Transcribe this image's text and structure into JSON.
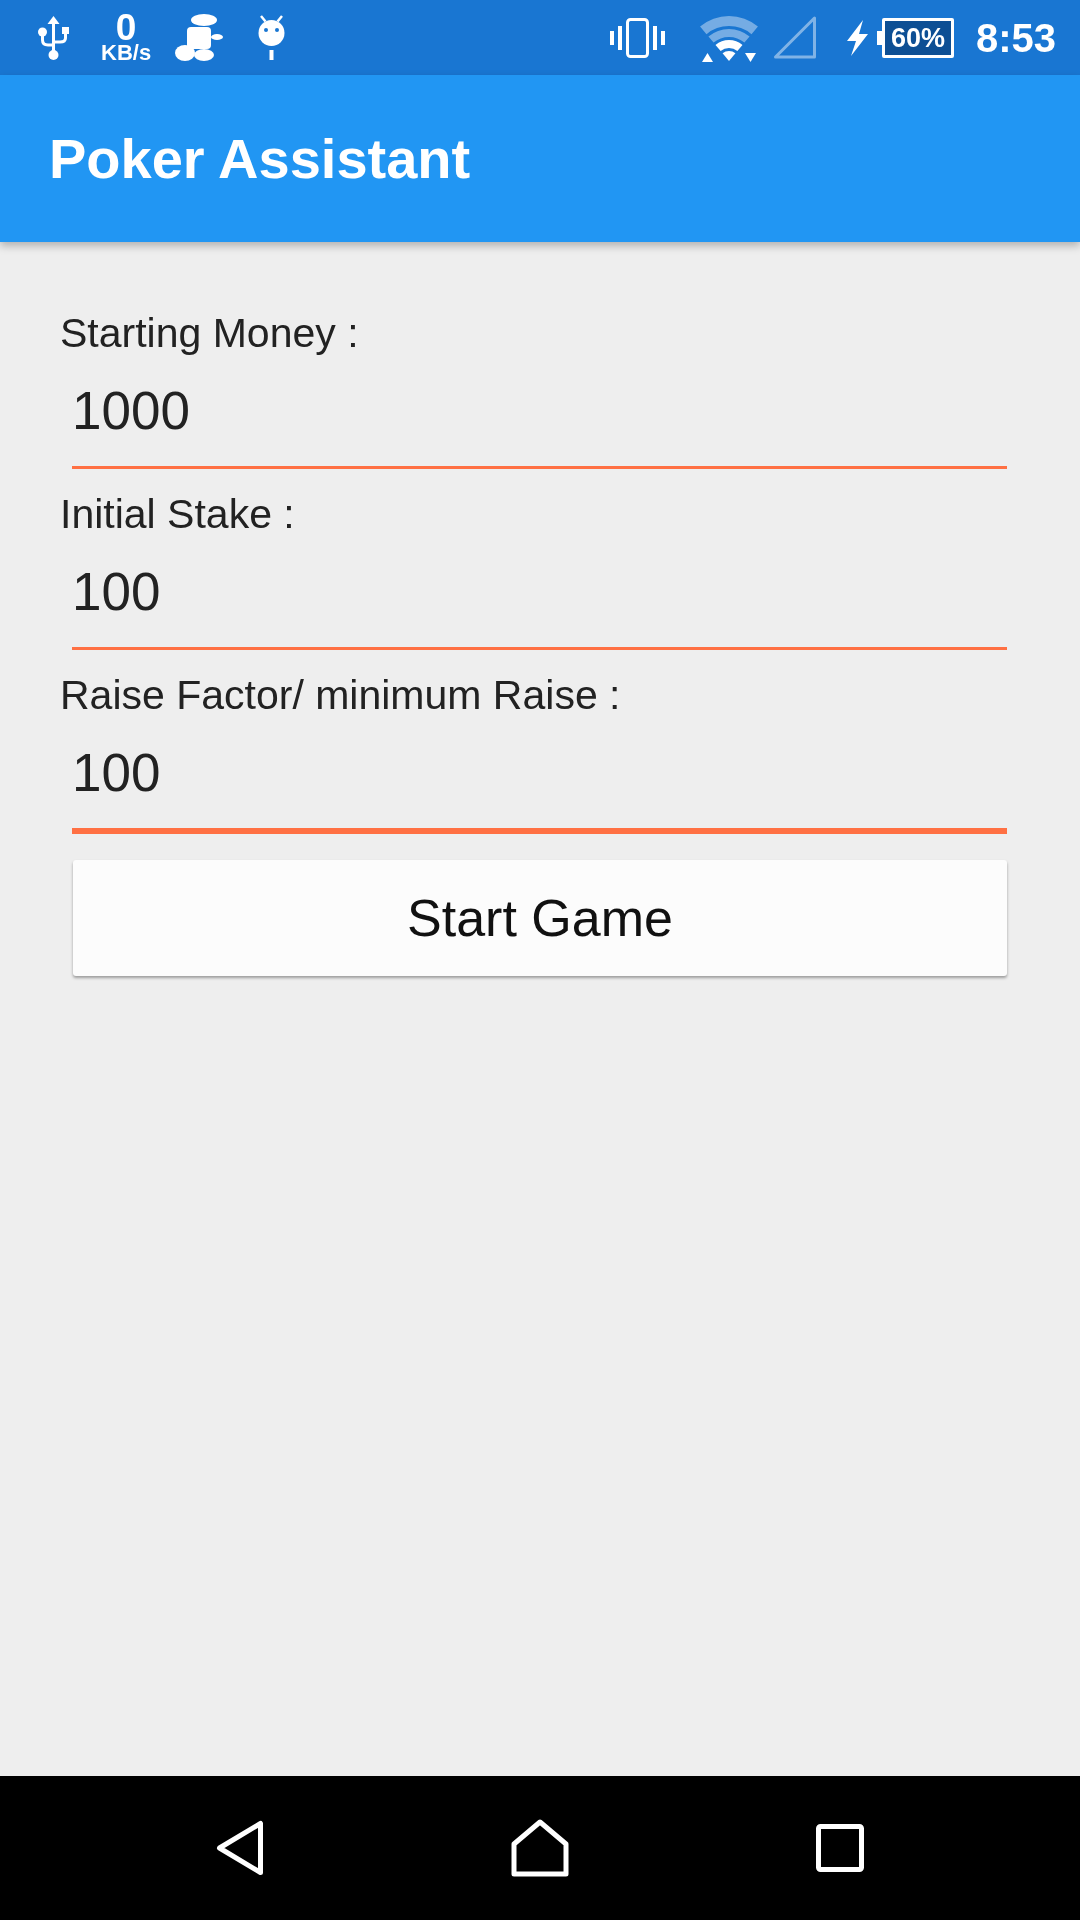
{
  "status_bar": {
    "network_speed": {
      "value": "0",
      "unit": "KB/s"
    },
    "battery": "60%",
    "time": "8:53"
  },
  "app_bar": {
    "title": "Poker Assistant"
  },
  "fields": [
    {
      "label": "Starting Money :",
      "value": "1000",
      "focused": false
    },
    {
      "label": "Initial Stake :",
      "value": "100",
      "focused": false
    },
    {
      "label": "Raise Factor/ minimum Raise :",
      "value": "100",
      "focused": true
    }
  ],
  "button": {
    "label": "Start Game"
  }
}
